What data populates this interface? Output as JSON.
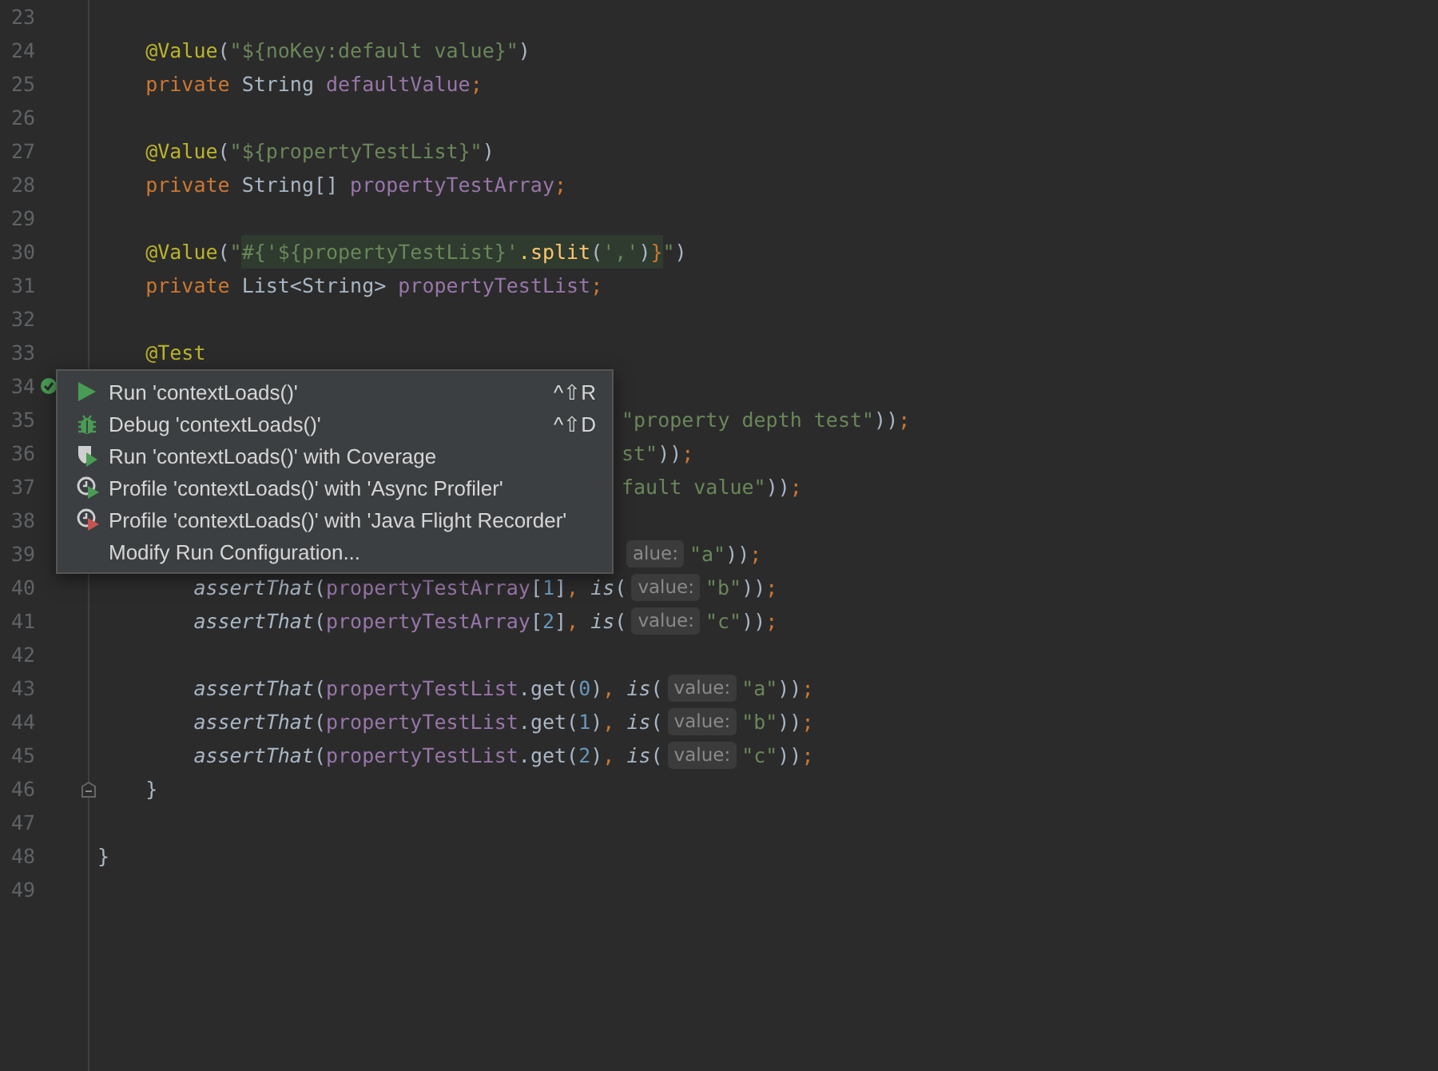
{
  "editor": {
    "lines_before": [
      {
        "number": "23"
      },
      {
        "number": "24",
        "tokens": [
          {
            "kind": "annotation",
            "text": "    @Value"
          },
          {
            "kind": "plain",
            "text": "("
          },
          {
            "kind": "string",
            "text": "\"${noKey:default value}\""
          },
          {
            "kind": "plain",
            "text": ")"
          }
        ]
      },
      {
        "number": "25",
        "tokens": [
          {
            "kind": "keyword",
            "text": "    private "
          },
          {
            "kind": "plain",
            "text": "String "
          },
          {
            "kind": "field",
            "text": "defaultValue"
          },
          {
            "kind": "keyword",
            "text": ";"
          }
        ]
      },
      {
        "number": "26"
      },
      {
        "number": "27",
        "tokens": [
          {
            "kind": "annotation",
            "text": "    @Value"
          },
          {
            "kind": "plain",
            "text": "("
          },
          {
            "kind": "string",
            "text": "\"${propertyTestList}\""
          },
          {
            "kind": "plain",
            "text": ")"
          }
        ]
      },
      {
        "number": "28",
        "tokens": [
          {
            "kind": "keyword",
            "text": "    private "
          },
          {
            "kind": "plain",
            "text": "String[] "
          },
          {
            "kind": "field",
            "text": "propertyTestArray"
          },
          {
            "kind": "keyword",
            "text": ";"
          }
        ]
      },
      {
        "number": "29"
      },
      {
        "number": "30",
        "tokens": [
          {
            "kind": "annotation",
            "text": "    @Value"
          },
          {
            "kind": "plain",
            "text": "("
          },
          {
            "kind": "string",
            "text": "\""
          },
          {
            "kind": "string",
            "text": "#{'${propertyTestList}'",
            "highlighted": true
          },
          {
            "kind": "method",
            "text": ".split",
            "highlighted": true
          },
          {
            "kind": "plain",
            "text": "(",
            "highlighted": true
          },
          {
            "kind": "string",
            "text": "','",
            "highlighted": true
          },
          {
            "kind": "plain",
            "text": ")",
            "highlighted": true
          },
          {
            "kind": "keyword",
            "text": "}",
            "highlighted": true
          },
          {
            "kind": "string",
            "text": "\""
          },
          {
            "kind": "plain",
            "text": ")"
          }
        ]
      },
      {
        "number": "31",
        "tokens": [
          {
            "kind": "keyword",
            "text": "    private "
          },
          {
            "kind": "plain",
            "text": "List<String> "
          },
          {
            "kind": "field",
            "text": "propertyTestList"
          },
          {
            "kind": "keyword",
            "text": ";"
          }
        ]
      },
      {
        "number": "32"
      },
      {
        "number": "33",
        "tokens": [
          {
            "kind": "annotation",
            "text": "    @Test"
          }
        ]
      }
    ],
    "popup_lines": [
      {
        "number": "34",
        "run_marker": true
      },
      {
        "number": "35",
        "tokens": [
          {
            "kind": "string",
            "text": "\"property depth test\""
          },
          {
            "kind": "plain",
            "text": "))"
          },
          {
            "kind": "keyword",
            "text": ";"
          }
        ]
      },
      {
        "number": "36",
        "tokens": [
          {
            "kind": "string",
            "text": "st\""
          },
          {
            "kind": "plain",
            "text": "))"
          },
          {
            "kind": "keyword",
            "text": ";"
          }
        ]
      },
      {
        "number": "37",
        "tokens": [
          {
            "kind": "string",
            "text": "fault value\""
          },
          {
            "kind": "plain",
            "text": "))"
          },
          {
            "kind": "keyword",
            "text": ";"
          }
        ]
      },
      {
        "number": "38"
      },
      {
        "number": "39",
        "tokens": [
          {
            "kind": "hint",
            "text": "alue:"
          },
          {
            "kind": "string",
            "text": "\"a\""
          },
          {
            "kind": "plain",
            "text": "))"
          },
          {
            "kind": "keyword",
            "text": ";"
          }
        ]
      }
    ],
    "lines_after": [
      {
        "number": "40",
        "tokens": [
          {
            "kind": "static",
            "text": "        assertThat"
          },
          {
            "kind": "plain",
            "text": "("
          },
          {
            "kind": "field",
            "text": "propertyTestArray"
          },
          {
            "kind": "plain",
            "text": "["
          },
          {
            "kind": "number",
            "text": "1"
          },
          {
            "kind": "plain",
            "text": "]"
          },
          {
            "kind": "keyword",
            "text": ", "
          },
          {
            "kind": "static",
            "text": "is"
          },
          {
            "kind": "plain",
            "text": "("
          },
          {
            "kind": "hint",
            "text": "value:"
          },
          {
            "kind": "string",
            "text": "\"b\""
          },
          {
            "kind": "plain",
            "text": "))"
          },
          {
            "kind": "keyword",
            "text": ";"
          }
        ]
      },
      {
        "number": "41",
        "tokens": [
          {
            "kind": "static",
            "text": "        assertThat"
          },
          {
            "kind": "plain",
            "text": "("
          },
          {
            "kind": "field",
            "text": "propertyTestArray"
          },
          {
            "kind": "plain",
            "text": "["
          },
          {
            "kind": "number",
            "text": "2"
          },
          {
            "kind": "plain",
            "text": "]"
          },
          {
            "kind": "keyword",
            "text": ", "
          },
          {
            "kind": "static",
            "text": "is"
          },
          {
            "kind": "plain",
            "text": "("
          },
          {
            "kind": "hint",
            "text": "value:"
          },
          {
            "kind": "string",
            "text": "\"c\""
          },
          {
            "kind": "plain",
            "text": "))"
          },
          {
            "kind": "keyword",
            "text": ";"
          }
        ]
      },
      {
        "number": "42"
      },
      {
        "number": "43",
        "tokens": [
          {
            "kind": "static",
            "text": "        assertThat"
          },
          {
            "kind": "plain",
            "text": "("
          },
          {
            "kind": "field",
            "text": "propertyTestList"
          },
          {
            "kind": "plain",
            "text": ".get("
          },
          {
            "kind": "number",
            "text": "0"
          },
          {
            "kind": "plain",
            "text": ")"
          },
          {
            "kind": "keyword",
            "text": ", "
          },
          {
            "kind": "static",
            "text": "is"
          },
          {
            "kind": "plain",
            "text": "("
          },
          {
            "kind": "hint",
            "text": "value:"
          },
          {
            "kind": "string",
            "text": "\"a\""
          },
          {
            "kind": "plain",
            "text": "))"
          },
          {
            "kind": "keyword",
            "text": ";"
          }
        ]
      },
      {
        "number": "44",
        "tokens": [
          {
            "kind": "static",
            "text": "        assertThat"
          },
          {
            "kind": "plain",
            "text": "("
          },
          {
            "kind": "field",
            "text": "propertyTestList"
          },
          {
            "kind": "plain",
            "text": ".get("
          },
          {
            "kind": "number",
            "text": "1"
          },
          {
            "kind": "plain",
            "text": ")"
          },
          {
            "kind": "keyword",
            "text": ", "
          },
          {
            "kind": "static",
            "text": "is"
          },
          {
            "kind": "plain",
            "text": "("
          },
          {
            "kind": "hint",
            "text": "value:"
          },
          {
            "kind": "string",
            "text": "\"b\""
          },
          {
            "kind": "plain",
            "text": "))"
          },
          {
            "kind": "keyword",
            "text": ";"
          }
        ]
      },
      {
        "number": "45",
        "tokens": [
          {
            "kind": "static",
            "text": "        assertThat"
          },
          {
            "kind": "plain",
            "text": "("
          },
          {
            "kind": "field",
            "text": "propertyTestList"
          },
          {
            "kind": "plain",
            "text": ".get("
          },
          {
            "kind": "number",
            "text": "2"
          },
          {
            "kind": "plain",
            "text": ")"
          },
          {
            "kind": "keyword",
            "text": ", "
          },
          {
            "kind": "static",
            "text": "is"
          },
          {
            "kind": "plain",
            "text": "("
          },
          {
            "kind": "hint",
            "text": "value:"
          },
          {
            "kind": "string",
            "text": "\"c\""
          },
          {
            "kind": "plain",
            "text": "))"
          },
          {
            "kind": "keyword",
            "text": ";"
          }
        ]
      },
      {
        "number": "46",
        "foldable": true,
        "tokens": [
          {
            "kind": "plain",
            "text": "    }"
          }
        ]
      },
      {
        "number": "47"
      },
      {
        "number": "48",
        "tokens": [
          {
            "kind": "plain",
            "text": "}"
          }
        ]
      },
      {
        "number": "49"
      }
    ],
    "popup": {
      "items": [
        {
          "kind": "run",
          "label": "Run 'contextLoads()'",
          "shortcut": "^⇧R"
        },
        {
          "kind": "debug",
          "label": "Debug 'contextLoads()'",
          "shortcut": "^⇧D"
        },
        {
          "kind": "coverage",
          "label": "Run 'contextLoads()' with Coverage"
        },
        {
          "kind": "profile",
          "label": "Profile 'contextLoads()' with 'Async Profiler'"
        },
        {
          "kind": "profile_record",
          "label": "Profile 'contextLoads()' with 'Java Flight Recorder'"
        },
        {
          "kind": "plain",
          "label": "Modify Run Configuration..."
        }
      ]
    }
  }
}
